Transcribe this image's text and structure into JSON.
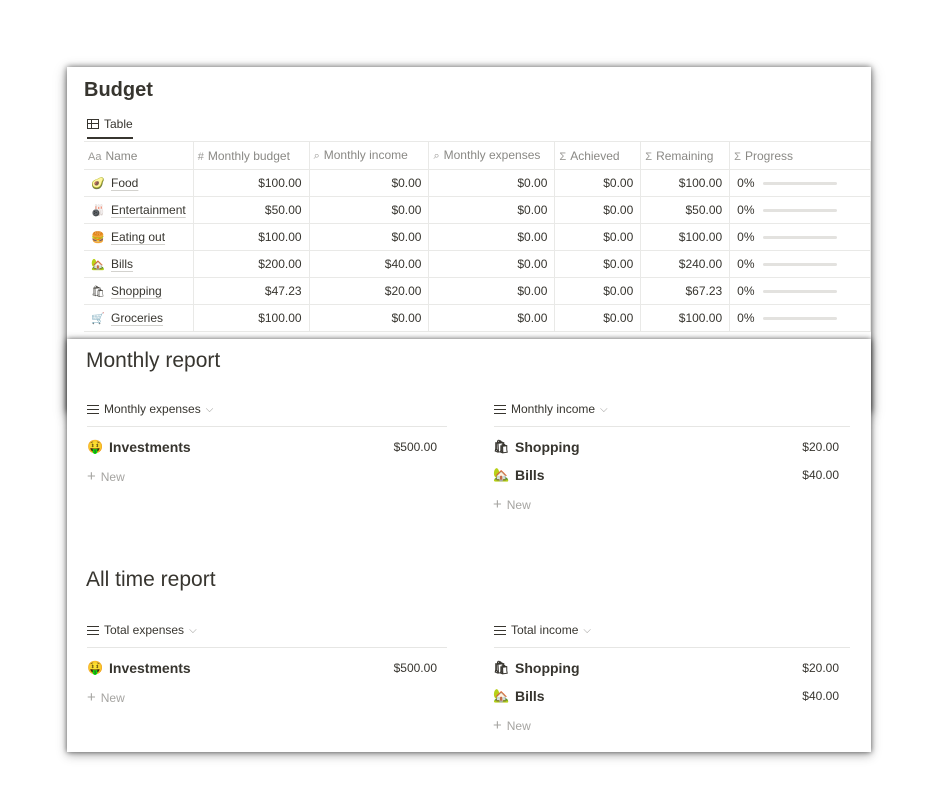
{
  "budget": {
    "title": "Budget",
    "view_tab": "Table",
    "columns": [
      {
        "icon": "Aa",
        "label": "Name"
      },
      {
        "icon": "#",
        "label": "Monthly budget"
      },
      {
        "icon": "⌕",
        "label": "Monthly income"
      },
      {
        "icon": "⌕",
        "label": "Monthly expenses"
      },
      {
        "icon": "Σ",
        "label": "Achieved"
      },
      {
        "icon": "Σ",
        "label": "Remaining"
      },
      {
        "icon": "Σ",
        "label": "Progress"
      }
    ],
    "rows": [
      {
        "emoji": "🥑",
        "name": "Food",
        "budget": "$100.00",
        "income": "$0.00",
        "expenses": "$0.00",
        "achieved": "$0.00",
        "remaining": "$100.00",
        "progress_text": "0%",
        "progress": 0
      },
      {
        "emoji": "🎳",
        "name": "Entertainment",
        "budget": "$50.00",
        "income": "$0.00",
        "expenses": "$0.00",
        "achieved": "$0.00",
        "remaining": "$50.00",
        "progress_text": "0%",
        "progress": 0
      },
      {
        "emoji": "🍔",
        "name": "Eating out",
        "budget": "$100.00",
        "income": "$0.00",
        "expenses": "$0.00",
        "achieved": "$0.00",
        "remaining": "$100.00",
        "progress_text": "0%",
        "progress": 0
      },
      {
        "emoji": "🏡",
        "name": "Bills",
        "budget": "$200.00",
        "income": "$40.00",
        "expenses": "$0.00",
        "achieved": "$0.00",
        "remaining": "$240.00",
        "progress_text": "0%",
        "progress": 0
      },
      {
        "emoji": "🛍",
        "name": "Shopping",
        "budget": "$47.23",
        "income": "$20.00",
        "expenses": "$0.00",
        "achieved": "$0.00",
        "remaining": "$67.23",
        "progress_text": "0%",
        "progress": 0
      },
      {
        "emoji": "🛒",
        "name": "Groceries",
        "budget": "$100.00",
        "income": "$0.00",
        "expenses": "$0.00",
        "achieved": "$0.00",
        "remaining": "$100.00",
        "progress_text": "0%",
        "progress": 0
      }
    ]
  },
  "monthly_report": {
    "title": "Monthly report",
    "expenses": {
      "label": "Monthly expenses",
      "items": [
        {
          "emoji": "🤑",
          "name": "Investments",
          "amount": "$500.00"
        }
      ],
      "new_label": "New"
    },
    "income": {
      "label": "Monthly income",
      "items": [
        {
          "emoji": "🛍",
          "name": "Shopping",
          "amount": "$20.00"
        },
        {
          "emoji": "🏡",
          "name": "Bills",
          "amount": "$40.00"
        }
      ],
      "new_label": "New"
    }
  },
  "all_time_report": {
    "title": "All time report",
    "expenses": {
      "label": "Total expenses",
      "items": [
        {
          "emoji": "🤑",
          "name": "Investments",
          "amount": "$500.00"
        }
      ],
      "new_label": "New"
    },
    "income": {
      "label": "Total income",
      "items": [
        {
          "emoji": "🛍",
          "name": "Shopping",
          "amount": "$20.00"
        },
        {
          "emoji": "🏡",
          "name": "Bills",
          "amount": "$40.00"
        }
      ],
      "new_label": "New"
    }
  },
  "colors": {
    "text": "#37352f",
    "muted": "#9b9a97",
    "progress_fill": "#2e9c75"
  }
}
